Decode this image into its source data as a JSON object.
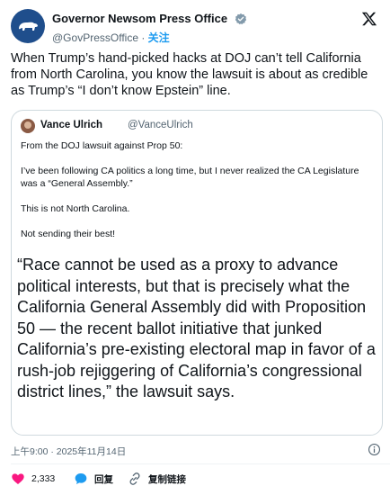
{
  "author": {
    "display_name": "Governor Newsom Press Office",
    "handle": "@GovPressOffice",
    "separator": " · ",
    "follow_label": "关注"
  },
  "tweet_text": "When Trump’s hand-picked hacks at DOJ can’t tell California from North Carolina, you know the lawsuit is about as credible as Trump’s “I don’t know Epstein” line.",
  "quoted": {
    "display_name": "Vance Ulrich",
    "handle": "@VanceUlrich",
    "paragraphs": [
      "From the DOJ lawsuit against Prop 50:",
      "I’ve been following CA politics a long time, but I never realized the CA Legislature was a “General Assembly.”",
      "This is not North Carolina.",
      "Not sending their best!"
    ],
    "excerpt": "“Race cannot be used as a proxy to advance political interests, but that is precisely what the California General Assembly did with Proposition 50 — the recent ballot initiative that junked California’s pre-existing electoral map in favor of a rush-job rejiggering of California’s congressional district lines,” the lawsuit says."
  },
  "timestamp": "上午9:00 · 2025年11月14日",
  "actions": {
    "like_count": "2,333",
    "reply_label": "回复",
    "copy_link_label": "复制链接"
  },
  "colors": {
    "accent": "#1d9bf0",
    "like": "#f91880",
    "avatar_bg": "#1f4e8c"
  }
}
